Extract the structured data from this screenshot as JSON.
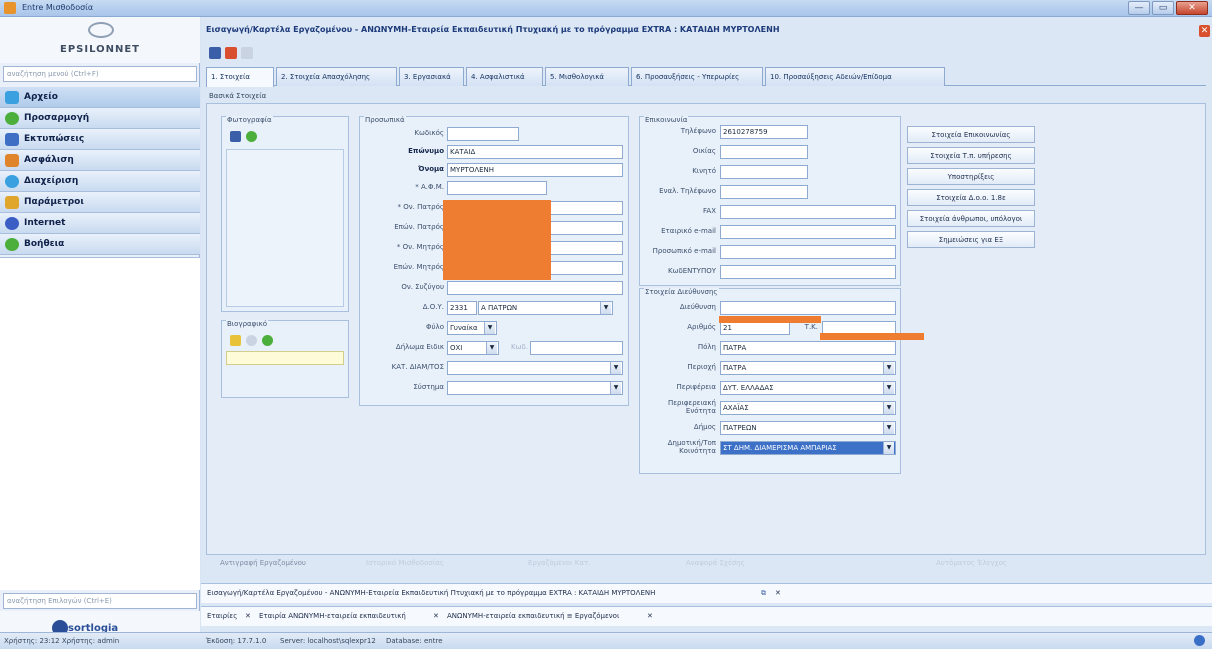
{
  "window": {
    "title": "Entre Μισθοδοσία",
    "btn_min": "—",
    "btn_max": "▭",
    "btn_close": "✕"
  },
  "brand": {
    "name": "EPSILONNET"
  },
  "left": {
    "search_placeholder": "αναζήτηση μενού (Ctrl+F)",
    "nav": [
      {
        "label": "Αρχείο",
        "color": "#3aa0df"
      },
      {
        "label": "Προσαρμογή",
        "color": "#4caf3c"
      },
      {
        "label": "Εκτυπώσεις",
        "color": "#3f6fc4"
      },
      {
        "label": "Ασφάλιση",
        "color": "#e0842c"
      },
      {
        "label": "Διαχείριση",
        "color": "#3aa0df"
      },
      {
        "label": "Παράμετροι",
        "color": "#e0a62c"
      },
      {
        "label": "Internet",
        "color": "#3a5ec4"
      },
      {
        "label": "Βοήθεια",
        "color": "#4caf3c"
      }
    ],
    "search2_placeholder": "αναζήτηση Επιλογών (Ctrl+E)",
    "partner": "sortlogia"
  },
  "doc": {
    "title": "Εισαγωγή/Καρτέλα Εργαζομένου - ΑΝΩΝΥΜΗ-Εταιρεία Εκπαιδευτική Πτυχιακή με το πρόγραμμα EXTRA : ΚΑΤΑΙΔΗ ΜΥΡΤΟΛΕΝΗ",
    "close": "✕"
  },
  "tabs": [
    "1. Στοιχεία",
    "2. Στοιχεία Απασχόλησης",
    "3. Εργασιακά",
    "4. Ασφαλιστικά",
    "5. Μισθολογικά",
    "6. Προσαυξήσεις - Υπερωρίες",
    "10. Προσαύξησεις Αδειών/Επίδομα"
  ],
  "section": "Βασικά Στοιχεία",
  "groups": {
    "photo": "Φωτογραφία",
    "bio": "Βιογραφικό",
    "personal": "Προσωπικά",
    "contact": "Επικοινωνία",
    "address": "Στοιχεία Διεύθυνσης"
  },
  "personal": {
    "code_label": "Κωδικός",
    "code": "",
    "surname_label": "Επώνυμο",
    "surname": "ΚΑΤΑΙΔ",
    "name_label": "Όνομα",
    "name": "ΜΥΡΤΟΛΕΝΗ",
    "afm_label": "* Α.Φ.Μ.",
    "father_label": "* Ον. Πατρός",
    "father_sur_label": "Επών. Πατρός",
    "mother_label": "* Ον. Μητρός",
    "mother_sur_label": "Επών. Μητρός",
    "spouse_label": "Ον. Συζύγου",
    "doy_label": "Δ.Ο.Υ.",
    "doy_code": "2331",
    "doy_name": "Α ΠΑΤΡΩΝ",
    "sex_label": "Φύλο",
    "sex": "Γυναίκα",
    "loan_label": "Δήλωμα Ειδικ",
    "loan": "ΟΧΙ",
    "loan_code": "Κωδ.",
    "ktp_label": "ΚΑΤ. ΔΙΑΜ/ΤΟΣ",
    "group_label": "Σύστημα"
  },
  "contact": {
    "phone_label": "Τηλέφωνο",
    "phone": "2610278759",
    "home_label": "Οικίας",
    "mobile_label": "Κινητό",
    "work_label": "Εναλ. Τηλέφωνο",
    "fax_label": "FAX",
    "email_label": "Εταιρικό e-mail",
    "email2_label": "Προσωπικό e-mail",
    "extra_label": "ΚωδΕΝΤΥΠΟΥ"
  },
  "address": {
    "street_label": "Διεύθυνση",
    "number_label": "Αριθμός",
    "number": "21",
    "zip_label": "Τ.Κ.",
    "city_label": "Πόλη",
    "city": "ΠΑΤΡΑ",
    "area_label": "Περιοχή",
    "area": "ΠΑΤΡΑ",
    "region_label": "Περιφέρεια",
    "region": "ΔΥΤ. ΕΛΛΑΔΑΣ",
    "unit_label": "Περιφερειακή Ενότητα",
    "unit": "ΑΧΑΪΑΣ",
    "muni_label": "Δήμος",
    "muni": "ΠΑΤΡΕΩΝ",
    "comm_label": "Δημοτική/Τοπ Κοινότητα",
    "comm": "ΣΤ ΔΗΜ. ΔΙΑΜΕΡΙΣΜΑ ΑΜΠΑΡΙΑΣ"
  },
  "right_buttons": [
    "Στοιχεία Επικοινωνίας",
    "Στοιχεία Τ.π. υπήρεσης",
    "Υποστηρίξεις",
    "Στοιχεία Δ.ο.ο. 1.8ε",
    "Στοιχεία άνθρωποι, υπόλογοι",
    "Σημειώσεις για ΕΞ"
  ],
  "bottom_actions": [
    "Αντιγραφή Εργαζομένου",
    "Ιστορικό Μισθοδοσίας",
    "Εργαζόμενοι Κατ.",
    "Αναφορά Σχέσης",
    "Αυτόματος Έλεγχος"
  ],
  "bottom_tab": "Εισαγωγή/Καρτέλα Εργαζομένου - ΑΝΩΝΥΜΗ-Εταιρεία Εκπαιδευτική Πτυχιακή με το πρόγραμμα EXTRA : ΚΑΤΑΙΔΗ ΜΥΡΤΟΛΕΝΗ",
  "bottom_tabs2": [
    "Εταιρίες",
    "Εταιρία ΑΝΩΝΥΜΗ-εταιρεία εκπαιδευτική",
    "ΑΝΩΝΥΜΗ-εταιρεία εκπαιδευτική ≡ Εργαζόμενοι"
  ],
  "status": {
    "user": "Χρήστης: 23:12  Χρήστης: admin",
    "version": "Έκδοση: 17.7.1.0",
    "server": "Server: localhost\\sqlexpr12",
    "db": "Database: entre"
  }
}
